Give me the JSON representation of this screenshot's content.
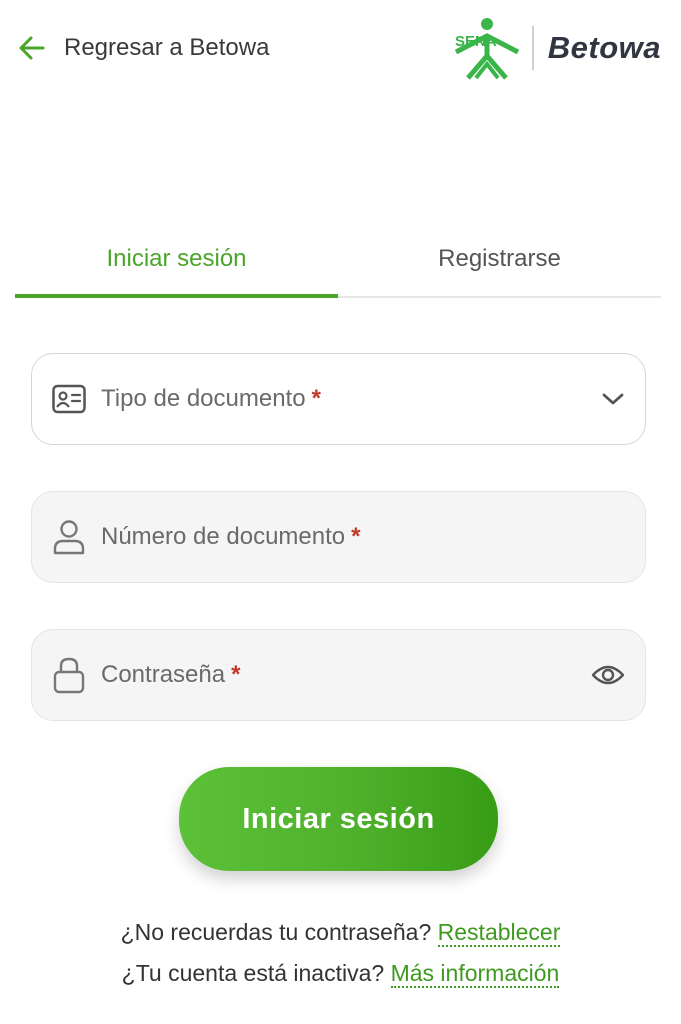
{
  "header": {
    "back_label": "Regresar a Betowa",
    "logo_text": "SENA",
    "brand_name": "Betowa"
  },
  "tabs": [
    {
      "label": "Iniciar sesión",
      "active": true
    },
    {
      "label": "Registrarse",
      "active": false
    }
  ],
  "form": {
    "document_type": {
      "placeholder": "Tipo de documento",
      "required_mark": "*",
      "icon": "id-card-icon",
      "trailing_icon": "chevron-down-icon"
    },
    "document_number": {
      "placeholder": "Número de documento",
      "required_mark": "*",
      "icon": "user-icon"
    },
    "password": {
      "placeholder": "Contraseña",
      "required_mark": "*",
      "icon": "lock-icon",
      "trailing_icon": "eye-icon"
    },
    "submit_label": "Iniciar sesión"
  },
  "help": {
    "forgot_text": "¿No recuerdas tu contraseña?",
    "forgot_link": "Restablecer",
    "inactive_text": "¿Tu cuenta está inactiva?",
    "inactive_link": "Más información"
  },
  "colors": {
    "accent": "#4aa52a",
    "required": "#c0392b",
    "text": "#333333"
  }
}
